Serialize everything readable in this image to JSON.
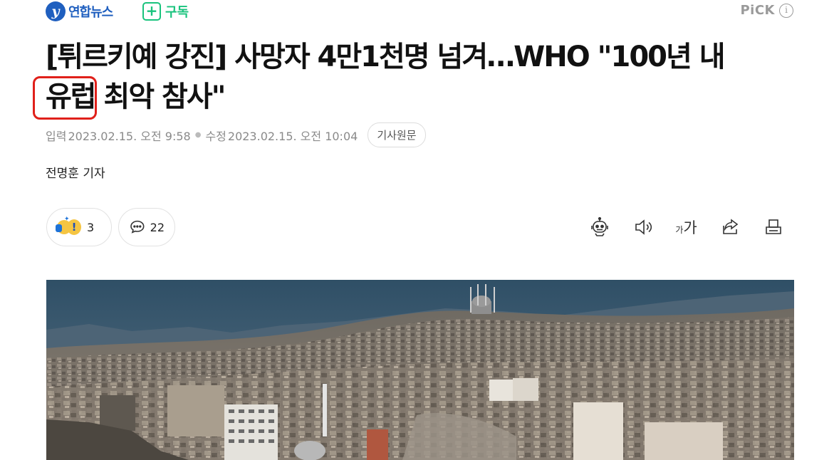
{
  "brand": {
    "name": "연합뉴스",
    "logo_icon": "yonhap-logo-icon"
  },
  "subscribe": {
    "label": "구독",
    "icon": "plus-icon",
    "color": "#19c37d"
  },
  "pick": {
    "label": "PiCK",
    "info_icon": "info-icon"
  },
  "article": {
    "headline_before": "[튀르키예 강진] 사망자 4만1천명 넘겨…WHO \"100년 내 ",
    "headline_highlight": "유럽",
    "headline_after": " 최악 참사\"",
    "highlight_color": "#e0201a",
    "input_label": "입력",
    "input_time": "2023.02.15. 오전 9:58",
    "modified_label": "수정",
    "modified_time": "2023.02.15. 오전 10:04",
    "original_button": "기사원문",
    "reporter": "전명훈 기자"
  },
  "actions": {
    "reaction_count": "3",
    "comment_count": "22",
    "tools": [
      "robot-summary-icon",
      "speaker-icon",
      "font-size-icon",
      "share-icon",
      "print-icon"
    ],
    "font_small": "가",
    "font_large": "가"
  },
  "photo": {
    "description_icon": "earthquake-city-photo"
  }
}
